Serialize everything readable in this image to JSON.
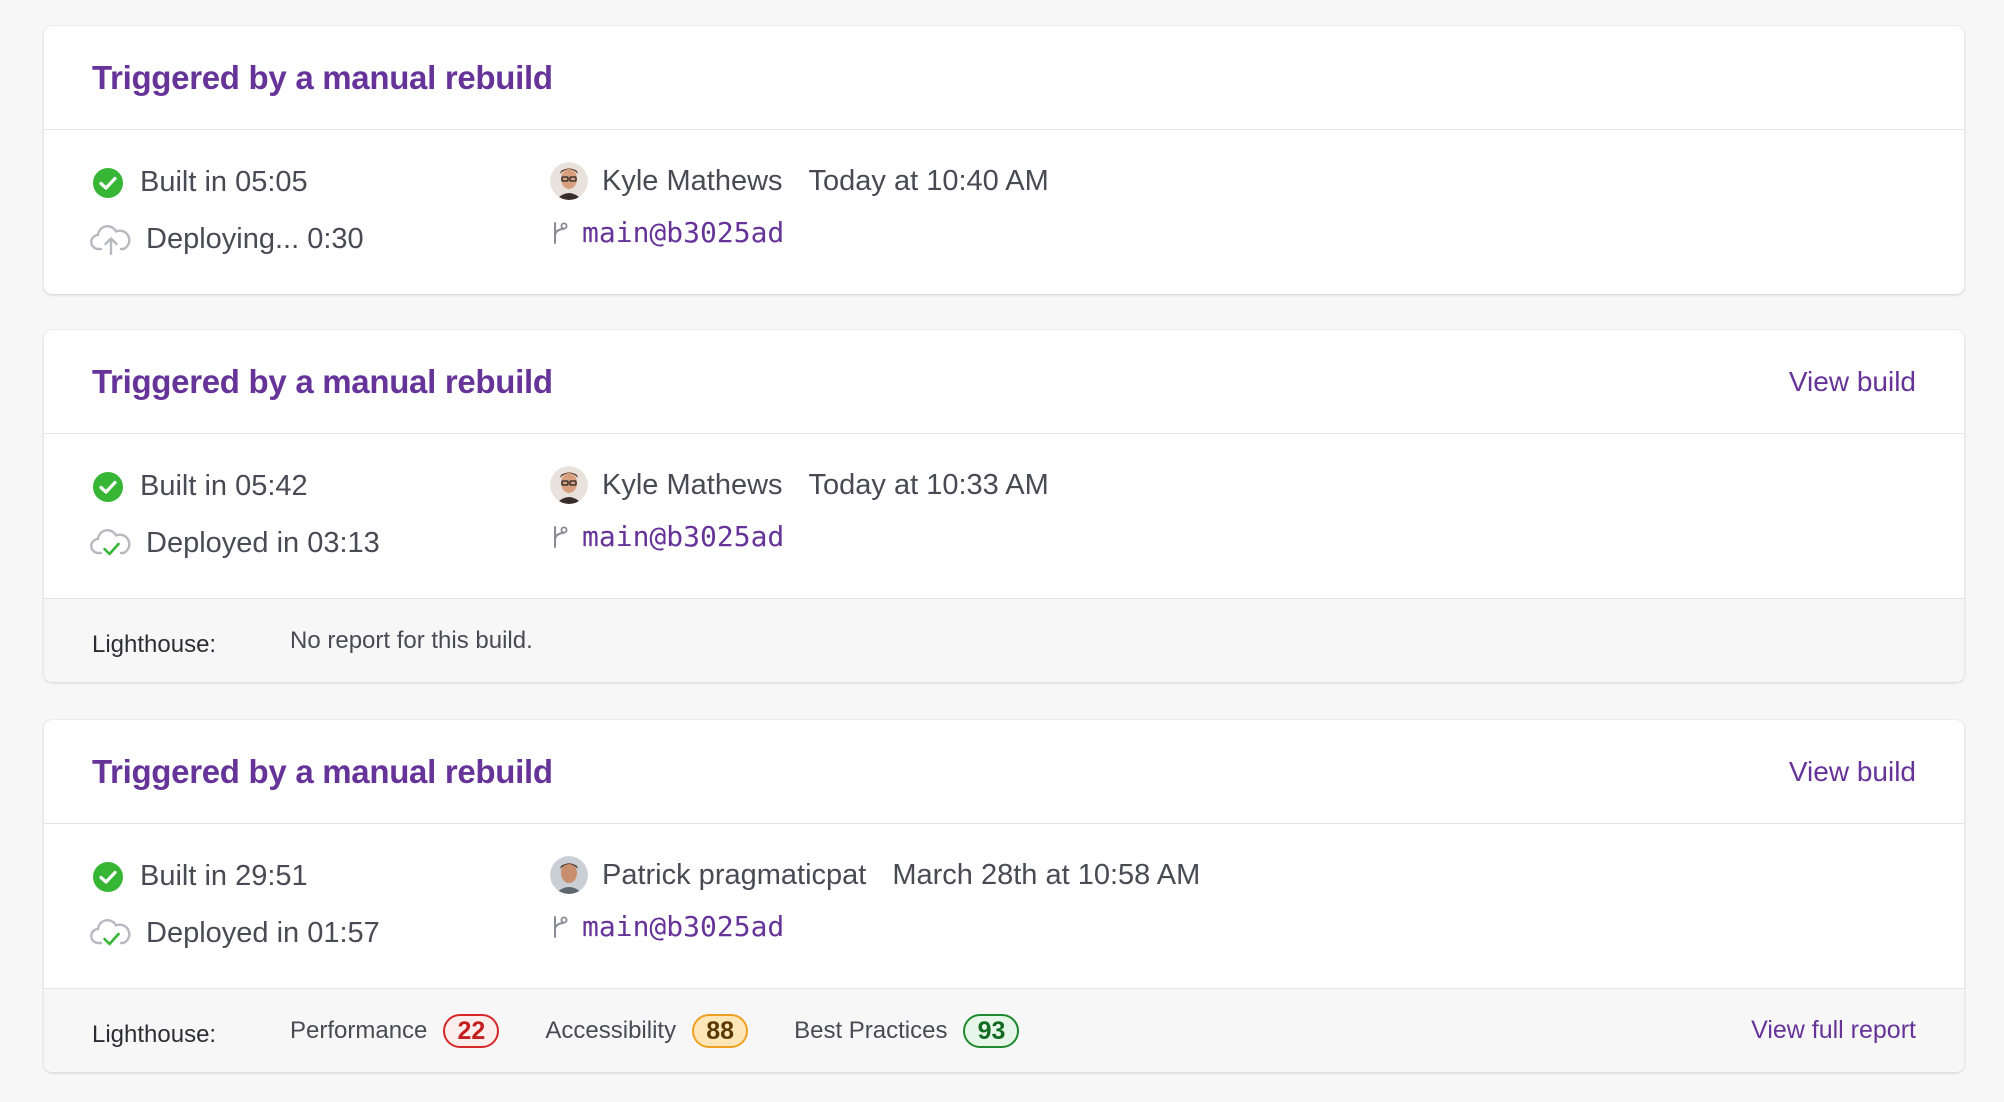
{
  "colors": {
    "accent": "#663399",
    "success": "#37b635",
    "score_red": "#d62828",
    "score_orange": "#f0a020",
    "score_green": "#1f8a2e"
  },
  "builds": [
    {
      "title": "Triggered by a manual rebuild",
      "view_build": "",
      "built": "Built in 05:05",
      "deploy": "Deploying... 0:30",
      "deploy_icon": "cloud-upload-icon",
      "author": "Kyle Mathews",
      "date": "Today at 10:40 AM",
      "branch": "main@b3025ad"
    },
    {
      "title": "Triggered by a manual rebuild",
      "view_build": "View build",
      "built": "Built in 05:42",
      "deploy": "Deployed in 03:13",
      "deploy_icon": "cloud-check-icon",
      "author": "Kyle Mathews",
      "date": "Today at 10:33 AM",
      "branch": "main@b3025ad",
      "lighthouse": {
        "label": "Lighthouse:",
        "empty": "No report for this build."
      }
    },
    {
      "title": "Triggered by a manual rebuild",
      "view_build": "View build",
      "built": "Built in 29:51",
      "deploy": "Deployed in 01:57",
      "deploy_icon": "cloud-check-icon",
      "author": "Patrick pragmaticpat",
      "date": "March 28th at 10:58 AM",
      "branch": "main@b3025ad",
      "lighthouse": {
        "label": "Lighthouse:",
        "scores": [
          {
            "name": "Performance",
            "value": "22",
            "level": "red"
          },
          {
            "name": "Accessibility",
            "value": "88",
            "level": "orange"
          },
          {
            "name": "Best Practices",
            "value": "93",
            "level": "green"
          }
        ],
        "full_report": "View full report"
      }
    }
  ]
}
